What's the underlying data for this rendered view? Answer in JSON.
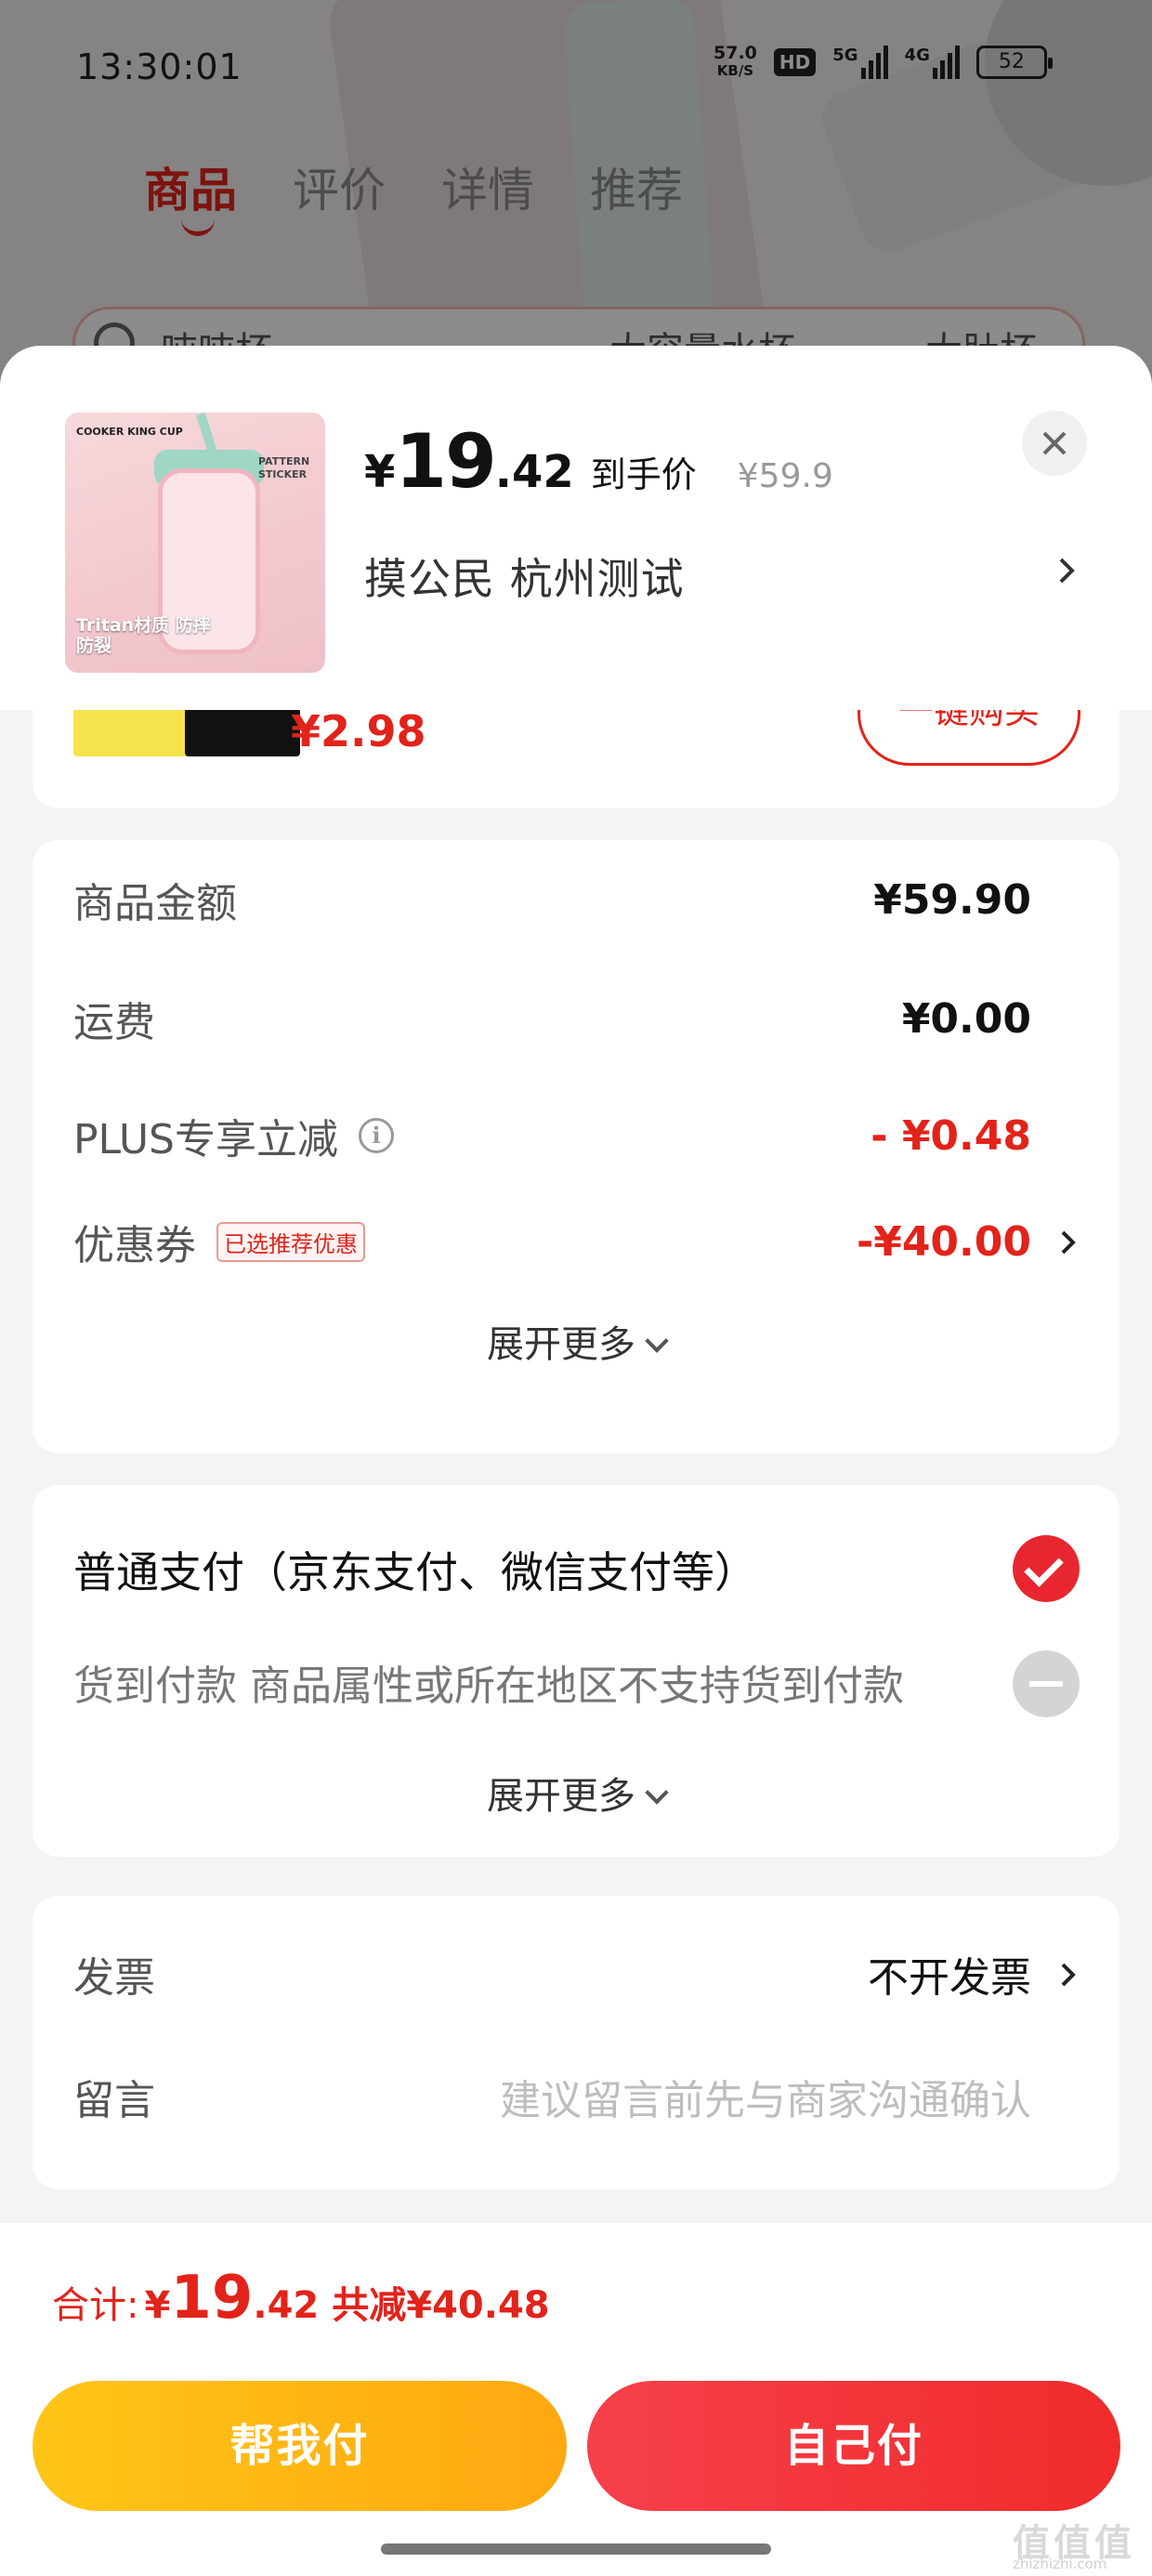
{
  "status_bar": {
    "time": "13:30:01",
    "net_speed_value": "57.0",
    "net_speed_unit": "KB/S",
    "hd": "HD",
    "sig1": "5G",
    "sig2": "4G",
    "battery": "52"
  },
  "background": {
    "tabs": [
      "商品",
      "评价",
      "详情",
      "推荐"
    ],
    "search_text": "吨吨杯",
    "chip1": "大容量水杯",
    "chip2": "大肚杯"
  },
  "product": {
    "thumb_brand": "COOKER KING CUP",
    "thumb_sticker": "PATTERN STICKER",
    "thumb_caption": "Tritan材质 防摔防裂",
    "yen": "¥",
    "price_int": "19",
    "price_dec": ".42",
    "price_label": "到手价",
    "original_price": "¥59.9",
    "address": "摸公民  杭州测试"
  },
  "peek": {
    "price": "¥2.98",
    "button": "一键购买"
  },
  "summary": {
    "rows": [
      {
        "label": "商品金额",
        "value": "¥59.90"
      },
      {
        "label": "运费",
        "value": "¥0.00"
      },
      {
        "label": "PLUS专享立减",
        "value": "- ¥0.48"
      },
      {
        "label": "优惠券",
        "value": "-¥40.00",
        "tag": "已选推荐优惠"
      }
    ],
    "more": "展开更多"
  },
  "payment": {
    "option1": "普通支付（京东支付、微信支付等）",
    "option2": "货到付款 商品属性或所在地区不支持货到付款",
    "more": "展开更多"
  },
  "extra": {
    "invoice_label": "发票",
    "invoice_value": "不开发票",
    "note_label": "留言",
    "note_placeholder": "建议留言前先与商家沟通确认"
  },
  "bottom": {
    "total_label": "合计:",
    "yen": "¥",
    "total_int": "19",
    "total_dec": ".42",
    "saved": "共减¥40.48",
    "btn_help": "帮我付",
    "btn_self": "自己付",
    "watermark": "值值值",
    "watermark_sub": "zhizhizhi.com"
  }
}
